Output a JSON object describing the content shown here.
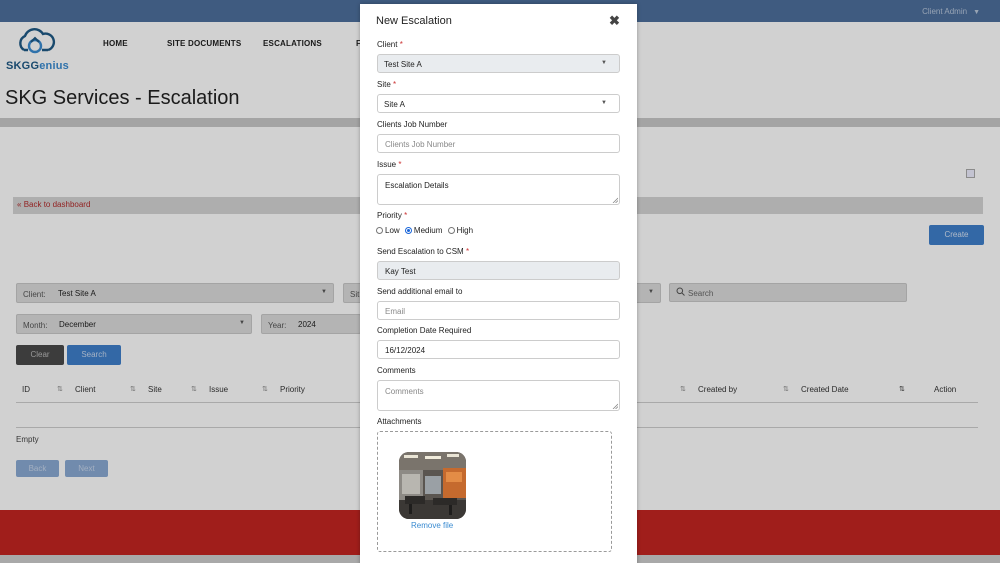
{
  "topbar": {
    "user_label": "Client Admin"
  },
  "header": {
    "brand": {
      "main": "SKG",
      "accent": "enius"
    },
    "nav": [
      "HOME",
      "SITE DOCUMENTS",
      "ESCALATIONS",
      "F"
    ]
  },
  "page": {
    "title": "SKG Services - Escalation",
    "back_link": "Back to dashboard",
    "create_label": "Create"
  },
  "filters": {
    "client_label": "Client:",
    "client_value": "Test Site A",
    "site_label": "Sit",
    "month_label": "Month:",
    "month_value": "December",
    "year_label": "Year:",
    "year_value": "2024",
    "search_placeholder": "Search",
    "clear_label": "Clear",
    "search_label": "Search"
  },
  "table": {
    "columns": [
      "ID",
      "Client",
      "Site",
      "Issue",
      "Priority",
      "Created by",
      "Created Date",
      "Action"
    ],
    "empty_text": "Empty",
    "back_label": "Back",
    "next_label": "Next"
  },
  "modal": {
    "title": "New Escalation",
    "close_glyph": "✖",
    "client": {
      "label": "Client",
      "value": "Test Site A"
    },
    "site": {
      "label": "Site",
      "value": "Site A"
    },
    "job_number": {
      "label": "Clients Job Number",
      "placeholder": "Clients Job Number"
    },
    "issue": {
      "label": "Issue",
      "value": "Escalation Details"
    },
    "priority": {
      "label": "Priority",
      "options": [
        "Low",
        "Medium",
        "High"
      ],
      "selected": "Medium"
    },
    "csm": {
      "label": "Send Escalation to CSM",
      "value": "Kay Test"
    },
    "additional_email": {
      "label": "Send additional email to",
      "placeholder": "Email"
    },
    "completion": {
      "label": "Completion Date Required",
      "value": "16/12/2024"
    },
    "comments": {
      "label": "Comments",
      "placeholder": "Comments"
    },
    "attachments": {
      "label": "Attachments",
      "remove_label": "Remove file"
    }
  },
  "colors": {
    "topbar": "#4d6f9d",
    "primary": "#3f7fcb",
    "footer": "#c42521",
    "link": "#3a8bd1"
  }
}
